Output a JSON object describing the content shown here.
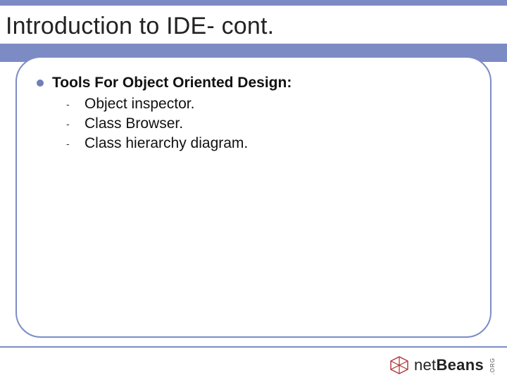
{
  "title": "Introduction to IDE- cont.",
  "bullet": {
    "heading": "Tools For Object Oriented Design:",
    "items": [
      "Object inspector.",
      "Class Browser.",
      "Class hierarchy diagram."
    ]
  },
  "logo": {
    "prefix": "net",
    "bold": "Beans",
    "suffix": ".ORG"
  },
  "colors": {
    "accent": "#7d8bc5"
  }
}
